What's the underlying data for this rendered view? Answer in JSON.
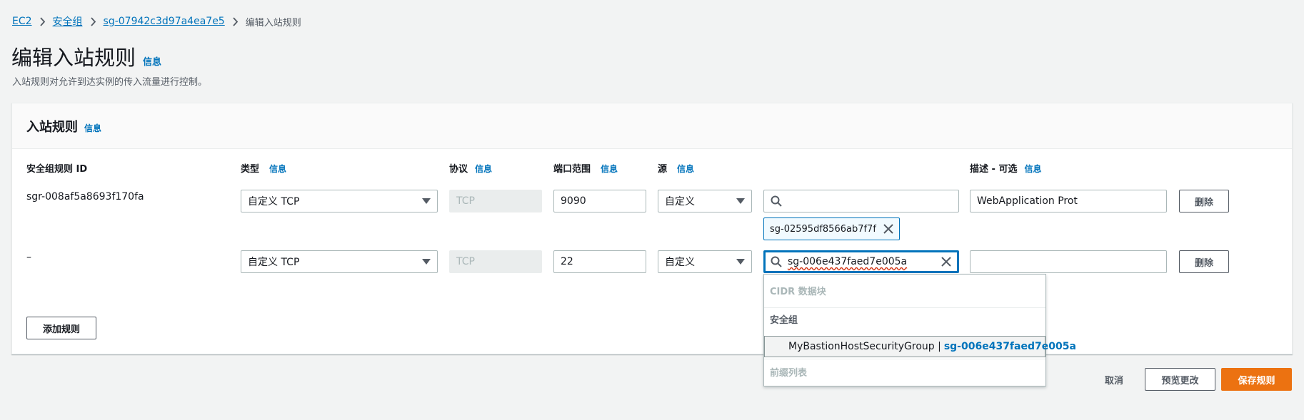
{
  "breadcrumb": {
    "ec2": "EC2",
    "security_groups": "安全组",
    "sg_id": "sg-07942c3d97a4ea7e5",
    "current": "编辑入站规则"
  },
  "page": {
    "title": "编辑入站规则",
    "info": "信息",
    "description": "入站规则对允许到达实例的传入流量进行控制。"
  },
  "panel": {
    "title": "入站规则",
    "info": "信息"
  },
  "columns": {
    "rule_id": "安全组规则 ID",
    "type": "类型",
    "protocol": "协议",
    "port_range": "端口范围",
    "source": "源",
    "description": "描述 - 可选",
    "info": "信息"
  },
  "rules": [
    {
      "id": "sgr-008af5a8693f170fa",
      "type": "自定义 TCP",
      "protocol": "TCP",
      "port": "9090",
      "source": "自定义",
      "search_value": "",
      "token": "sg-02595df8566ab7f7f",
      "description": "WebApplication Prot",
      "delete": "删除"
    },
    {
      "id": "–",
      "type": "自定义 TCP",
      "protocol": "TCP",
      "port": "22",
      "source": "自定义",
      "search_value": "sg-006e437faed7e005a",
      "description": "",
      "delete": "删除"
    }
  ],
  "dropdown": {
    "cidr_group": "CIDR 数据块",
    "sg_group": "安全组",
    "option_name": "MyBastionHostSecurityGroup |",
    "option_id": "sg-006e437faed7e005a",
    "prefix_group": "前缀列表"
  },
  "actions": {
    "add_rule": "添加规则",
    "cancel": "取消",
    "preview": "预览更改",
    "save": "保存规则"
  },
  "colors": {
    "link": "#0073bb",
    "primary": "#ec7211",
    "background": "#f2f3f3"
  }
}
